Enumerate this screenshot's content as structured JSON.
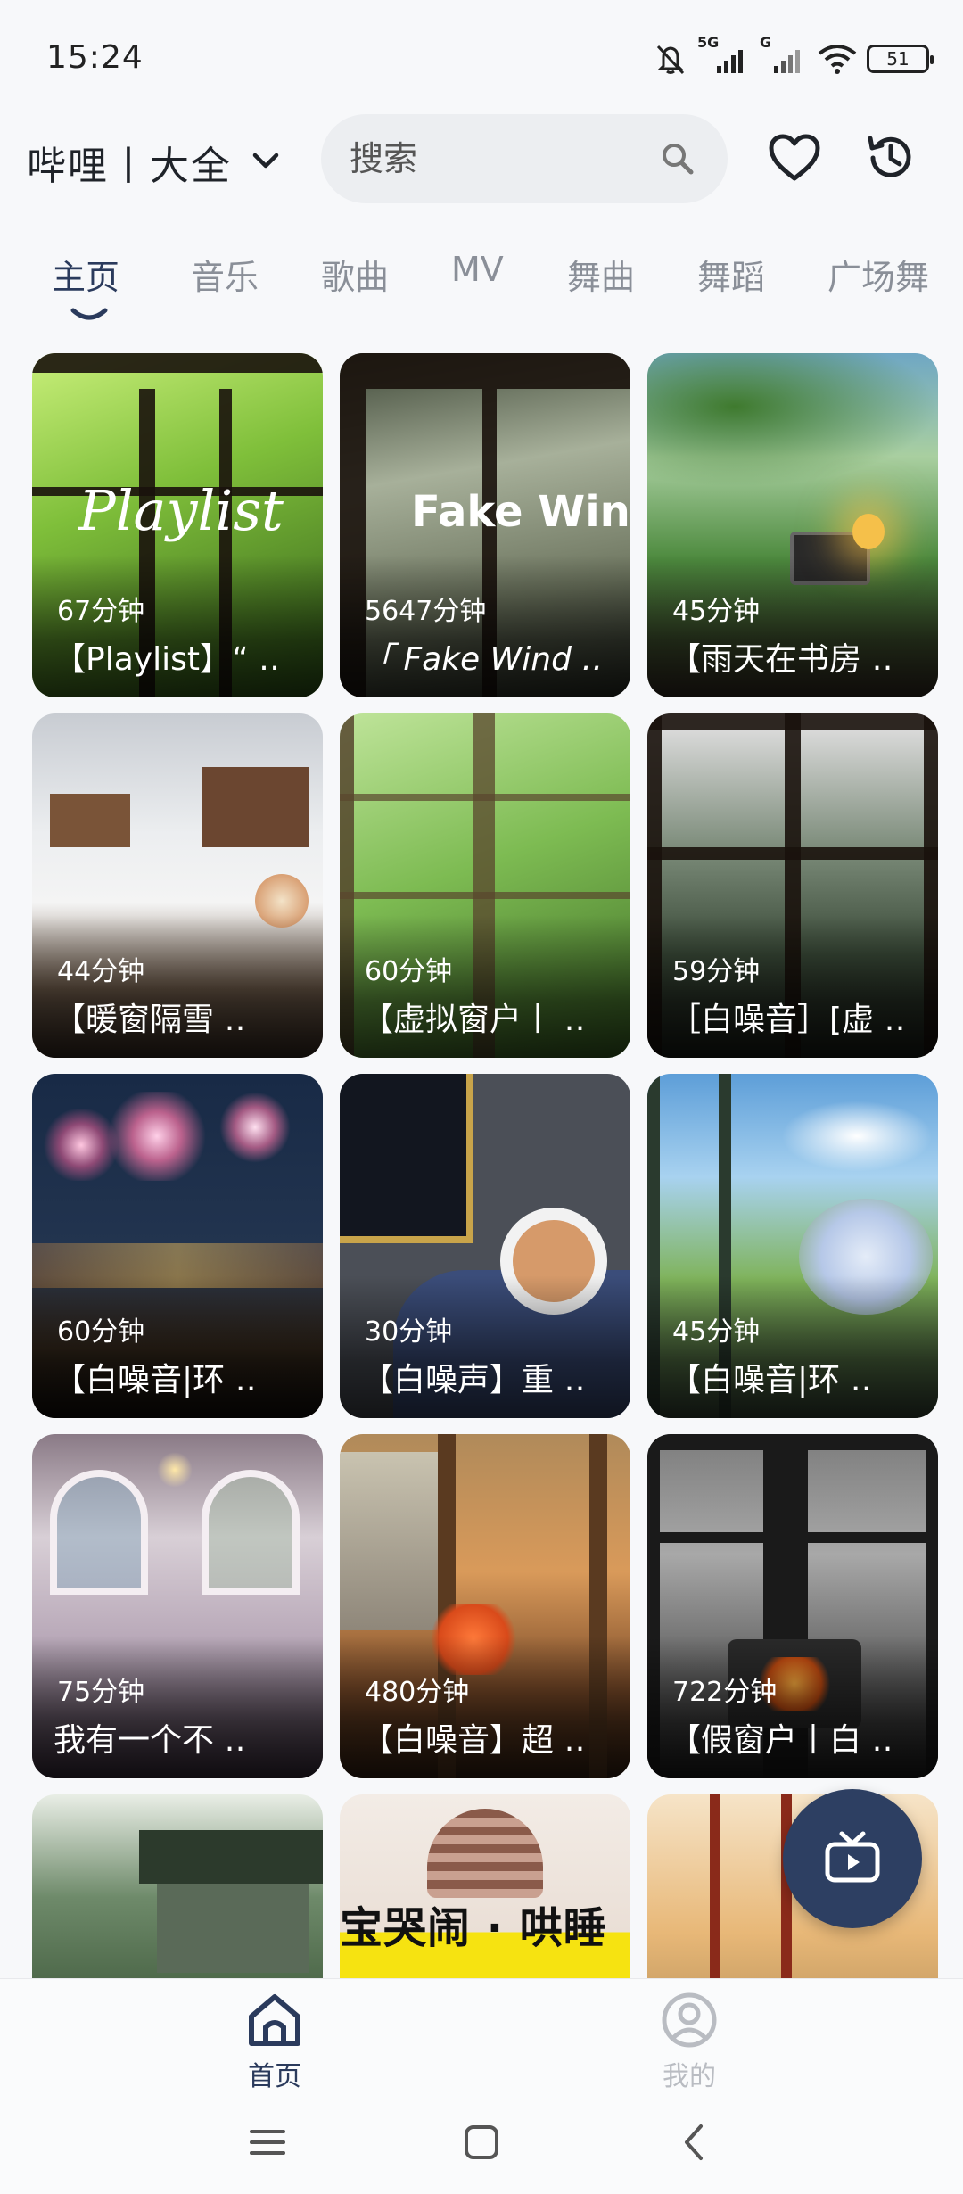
{
  "status_bar": {
    "time": "15:24",
    "battery": "51",
    "network_labels": [
      "5G",
      "G"
    ]
  },
  "header": {
    "title": "哔哩丨大全",
    "search_placeholder": "搜索"
  },
  "tabs": [
    {
      "label": "主页",
      "active": true
    },
    {
      "label": "音乐"
    },
    {
      "label": "歌曲"
    },
    {
      "label": "MV"
    },
    {
      "label": "舞曲"
    },
    {
      "label": "舞蹈"
    },
    {
      "label": "广场舞"
    }
  ],
  "cards": [
    {
      "duration": "67分钟",
      "title": "【Playlist】“ ‥",
      "overlay": "Playlist",
      "colors": [
        "#9bd14b",
        "#3b6f1c"
      ]
    },
    {
      "duration": "5647分钟",
      "title": "「 Fake Wind ‥",
      "overlay": "Fake Windo",
      "colors": [
        "#9aa28e",
        "#2d3528"
      ]
    },
    {
      "duration": "45分钟",
      "title": "【雨天在书房 ‥",
      "overlay": "",
      "colors": [
        "#7fb6cf",
        "#3f6b3a"
      ]
    },
    {
      "duration": "44分钟",
      "title": "【暖窗隔雪 ‥",
      "overlay": "",
      "colors": [
        "#e9ecef",
        "#6b5a4a"
      ]
    },
    {
      "duration": "60分钟",
      "title": "【虚拟窗户丨 ‥",
      "overlay": "",
      "colors": [
        "#8cc56a",
        "#355e22"
      ]
    },
    {
      "duration": "59分钟",
      "title": "［白噪音］[虚 ‥",
      "overlay": "",
      "colors": [
        "#7e8f7f",
        "#1f2a22"
      ]
    },
    {
      "duration": "60分钟",
      "title": "【白噪音|环 ‥",
      "overlay": "",
      "colors": [
        "#1f3350",
        "#1a1410"
      ]
    },
    {
      "duration": "30分钟",
      "title": "【白噪声】重 ‥",
      "overlay": "",
      "colors": [
        "#4a4f5a",
        "#3a4a73"
      ]
    },
    {
      "duration": "45分钟",
      "title": "【白噪音|环 ‥",
      "overlay": "",
      "colors": [
        "#7db8e8",
        "#5a8a4a"
      ]
    },
    {
      "duration": "75分钟",
      "title": "我有一个不 ‥",
      "overlay": "",
      "colors": [
        "#c9c2d6",
        "#5e4b5a"
      ]
    },
    {
      "duration": "480分钟",
      "title": "【白噪音】超 ‥",
      "overlay": "",
      "colors": [
        "#c9a77a",
        "#5b3a22"
      ]
    },
    {
      "duration": "722分钟",
      "title": "【假窗户丨白 ‥",
      "overlay": "",
      "colors": [
        "#9a9a9a",
        "#2a2a2a"
      ]
    },
    {
      "duration": "",
      "title": "",
      "overlay": "",
      "colors": [
        "#4c6b4a",
        "#26361f"
      ]
    },
    {
      "duration": "",
      "title": "",
      "overlay": "宝哭闹 · 哄睡",
      "colors": [
        "#f2e4d8",
        "#f6e311"
      ]
    },
    {
      "duration": "",
      "title": "",
      "overlay": "",
      "colors": [
        "#f3d9b5",
        "#8a6a3a"
      ]
    }
  ],
  "bottom_nav": {
    "home": "首页",
    "me": "我的"
  },
  "colors": {
    "accent": "#2d3f62",
    "tab_inactive": "#8a8f98",
    "background": "#f7f8fa"
  }
}
